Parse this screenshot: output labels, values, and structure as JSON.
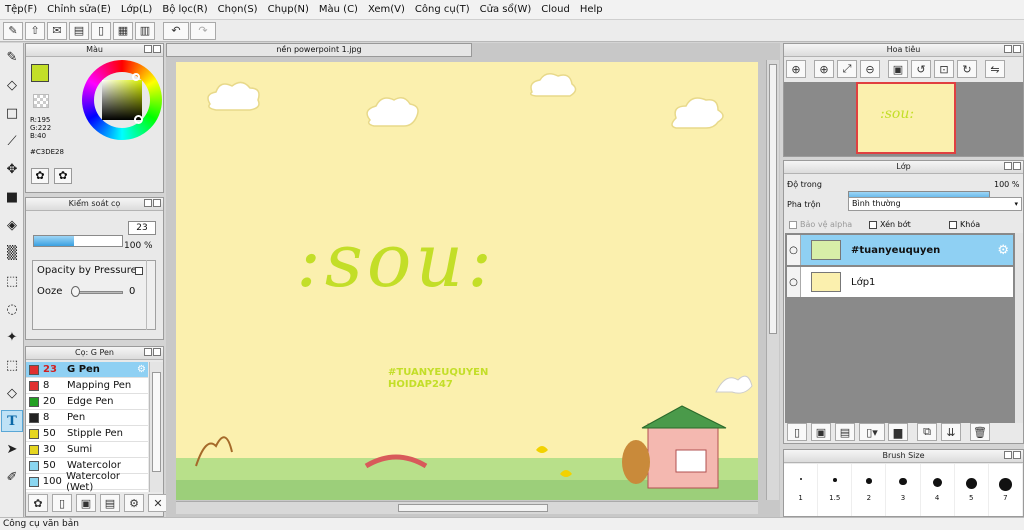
{
  "menu": [
    "Tệp(F)",
    "Chỉnh sửa(E)",
    "Lớp(L)",
    "Bộ lọc(R)",
    "Chọn(S)",
    "Chụp(N)",
    "Màu (C)",
    "Xem(V)",
    "Công cụ(T)",
    "Cửa sổ(W)",
    "Cloud",
    "Help"
  ],
  "color_panel": {
    "title": "Màu",
    "r": "R:195",
    "g": "G:222",
    "b": "B:40",
    "hex": "#C3DE28",
    "fg": "#C3DE28"
  },
  "brush_control": {
    "title": "Kiểm soát cọ",
    "size": "23",
    "opacity": "100 %",
    "size_fill": 0.45,
    "opacity_fill": 1.0,
    "pressure_label": "Opacity by Pressure",
    "ooze_label": "Ooze",
    "ooze_value": "0"
  },
  "brush_list": {
    "title": "Cọ: G Pen",
    "items": [
      {
        "size": "23",
        "name": "G Pen",
        "color": "#e03030",
        "selected": true
      },
      {
        "size": "8",
        "name": "Mapping Pen",
        "color": "#e03030"
      },
      {
        "size": "20",
        "name": "Edge Pen",
        "color": "#22a022"
      },
      {
        "size": "8",
        "name": "Pen",
        "color": "#222222"
      },
      {
        "size": "50",
        "name": "Stipple Pen",
        "color": "#e6d620"
      },
      {
        "size": "30",
        "name": "Sumi",
        "color": "#e6d620"
      },
      {
        "size": "50",
        "name": "Watercolor",
        "color": "#8ad6f0"
      },
      {
        "size": "100",
        "name": "Watercolor (Wet)",
        "color": "#8ad6f0"
      }
    ]
  },
  "document": {
    "tab": "nền powerpoint 1.jpg",
    "word": ":sou:",
    "tag1": "#TUANYEUQUYEN",
    "tag2": "HOIDAP247"
  },
  "navigator": {
    "title": "Hoa tiêu"
  },
  "layer_panel": {
    "title": "Lớp",
    "opacity_label": "Độ trong",
    "opacity_value": "100 %",
    "blend_label": "Pha trộn",
    "blend_value": "Bình thường",
    "protect_alpha": "Bảo vệ alpha",
    "clip": "Xén bớt",
    "lock": "Khóa",
    "layers": [
      {
        "name": "#tuanyeuquyen",
        "selected": true
      },
      {
        "name": "Lớp1",
        "selected": false
      }
    ]
  },
  "brush_size": {
    "title": "Brush Size",
    "sizes": [
      "1",
      "1.5",
      "2",
      "3",
      "4",
      "5",
      "7"
    ]
  },
  "status": "Công cụ văn bản"
}
